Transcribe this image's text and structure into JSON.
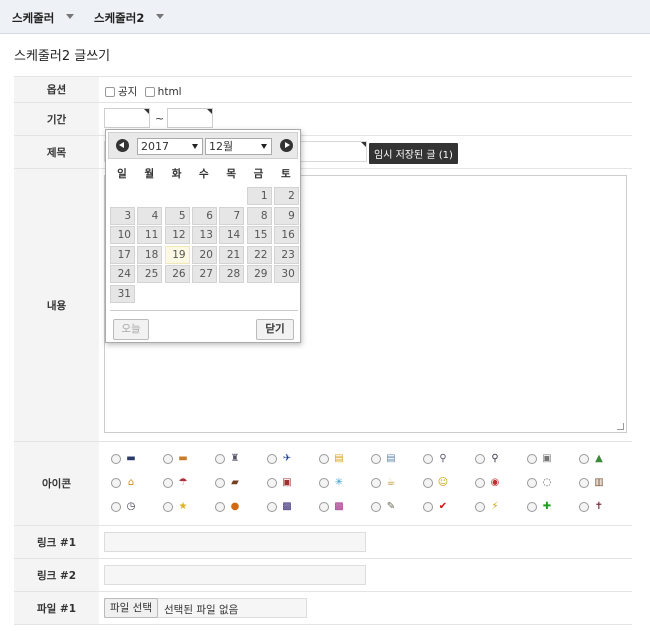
{
  "menu": [
    {
      "label": "스케줄러"
    },
    {
      "label": "스케줄러2"
    }
  ],
  "page_title": "스케줄러2 글쓰기",
  "fields": {
    "options_label": "옵션",
    "notice_label": "공지",
    "html_label": "html",
    "period_label": "기간",
    "period_sep": "~",
    "title_label": "제목",
    "temp_saved_label": "임시 저장된 글 (1)",
    "content_label": "내용",
    "icon_label": "아이콘",
    "link1_label": "링크 #1",
    "link2_label": "링크 #2",
    "file1_label": "파일 #1",
    "file_button": "파일 선택",
    "file_status": "선택된 파일 없음"
  },
  "datepicker": {
    "year": "2017",
    "month": "12월",
    "weekdays": [
      "일",
      "월",
      "화",
      "수",
      "목",
      "금",
      "토"
    ],
    "days": [
      "1",
      "2",
      "3",
      "4",
      "5",
      "6",
      "7",
      "8",
      "9",
      "10",
      "11",
      "12",
      "13",
      "14",
      "15",
      "16",
      "17",
      "18",
      "19",
      "20",
      "21",
      "22",
      "23",
      "24",
      "25",
      "26",
      "27",
      "28",
      "29",
      "30",
      "31"
    ],
    "first_weekday_index": 5,
    "today": "19",
    "today_button": "오늘",
    "close_button": "닫기"
  },
  "icons": [
    {
      "name": "briefcase-navy-icon",
      "glyph": "▬",
      "color": "#2a3a6a"
    },
    {
      "name": "bag-orange-icon",
      "glyph": "▬",
      "color": "#c87b2a"
    },
    {
      "name": "bell-icon",
      "glyph": "♜",
      "color": "#556"
    },
    {
      "name": "airplane-icon",
      "glyph": "✈",
      "color": "#2244aa"
    },
    {
      "name": "note-icon",
      "glyph": "▤",
      "color": "#d8a020"
    },
    {
      "name": "document-icon",
      "glyph": "▤",
      "color": "#6688aa"
    },
    {
      "name": "magnifier-icon",
      "glyph": "⚲",
      "color": "#556"
    },
    {
      "name": "search-icon",
      "glyph": "⚲",
      "color": "#334"
    },
    {
      "name": "gift-icon",
      "glyph": "▣",
      "color": "#777"
    },
    {
      "name": "landscape-icon",
      "glyph": "▲",
      "color": "#3a8a3a"
    },
    {
      "name": "house-icon",
      "glyph": "⌂",
      "color": "#d08a20"
    },
    {
      "name": "umbrella-icon",
      "glyph": "☂",
      "color": "#b03040"
    },
    {
      "name": "cake-icon",
      "glyph": "▰",
      "color": "#704020"
    },
    {
      "name": "tv-icon",
      "glyph": "▣",
      "color": "#a03030"
    },
    {
      "name": "snowflake-icon",
      "glyph": "✳",
      "color": "#3aa0d0"
    },
    {
      "name": "mug-icon",
      "glyph": "☕",
      "color": "#c09030"
    },
    {
      "name": "smiley-icon",
      "glyph": "☺",
      "color": "#c0a000"
    },
    {
      "name": "ball-icon",
      "glyph": "◉",
      "color": "#c03030"
    },
    {
      "name": "speech-bubble-icon",
      "glyph": "◌",
      "color": "#444"
    },
    {
      "name": "book-icon",
      "glyph": "▥",
      "color": "#7a5030"
    },
    {
      "name": "clock-icon",
      "glyph": "◷",
      "color": "#334"
    },
    {
      "name": "star-icon",
      "glyph": "★",
      "color": "#e0b020"
    },
    {
      "name": "pumpkin-icon",
      "glyph": "●",
      "color": "#d06a10"
    },
    {
      "name": "photo-purple-icon",
      "glyph": "▩",
      "color": "#302070"
    },
    {
      "name": "photo-pink-icon",
      "glyph": "▩",
      "color": "#a02080"
    },
    {
      "name": "tools-icon",
      "glyph": "✎",
      "color": "#665"
    },
    {
      "name": "checkmark-icon",
      "glyph": "✔",
      "color": "#d01010"
    },
    {
      "name": "lightning-icon",
      "glyph": "⚡",
      "color": "#d0a000"
    },
    {
      "name": "clover-icon",
      "glyph": "✚",
      "color": "#20a020"
    },
    {
      "name": "cross-icon",
      "glyph": "✝",
      "color": "#803040"
    }
  ]
}
